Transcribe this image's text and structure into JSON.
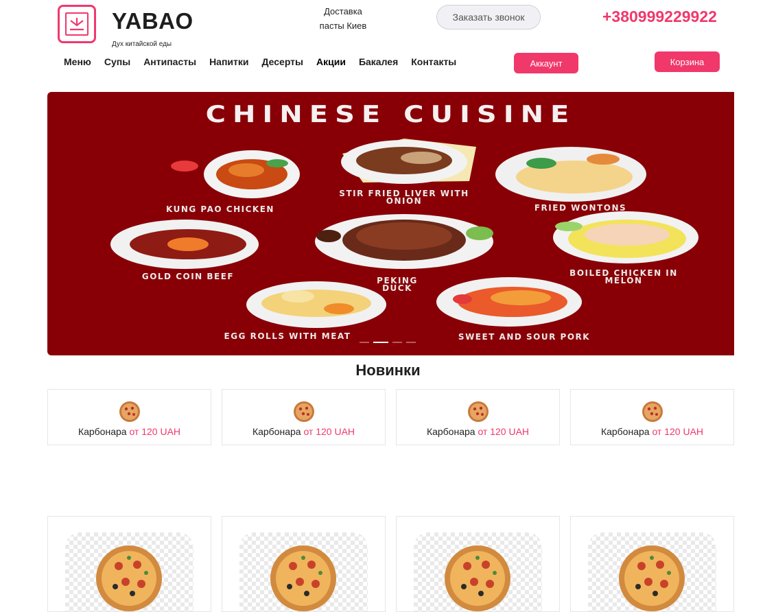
{
  "header": {
    "brand": "YABAO",
    "tagline": "Дух китайской еды",
    "delivery_line1": "Доставка",
    "delivery_line2": "пасты Киев",
    "call_button": "Заказать звонок",
    "phone": "+380999229922",
    "logo_icon": "box-icon"
  },
  "nav": {
    "items": [
      "Меню",
      "Супы",
      "Антипасты",
      "Напитки",
      "Десерты",
      "Акции",
      "Бакалея",
      "Контакты"
    ],
    "account": "Аккаунт",
    "cart": "Корзина"
  },
  "banner": {
    "title": "CHINESE CUISINE",
    "dishes": [
      "KUNG PAO CHICKEN",
      "STIR FRIED LIVER WITH ONION",
      "FRIED WONTONS",
      "GOLD COIN BEEF",
      "PEKING DUCK",
      "BOILED CHICKEN IN MELON",
      "EGG ROLLS WITH MEAT",
      "SWEET AND SOUR PORK"
    ],
    "slides_total": 4,
    "slide_active": 2,
    "background_color": "#880006"
  },
  "section": {
    "title": "Новинки"
  },
  "products": [
    {
      "name": "Карбонара",
      "price": "от 120 UAH"
    },
    {
      "name": "Карбонара",
      "price": "от 120 UAH"
    },
    {
      "name": "Карбонара",
      "price": "от 120 UAH"
    },
    {
      "name": "Карбонара",
      "price": "от 120 UAH"
    }
  ],
  "colors": {
    "accent": "#f0386b",
    "text": "#1e1e1e"
  }
}
